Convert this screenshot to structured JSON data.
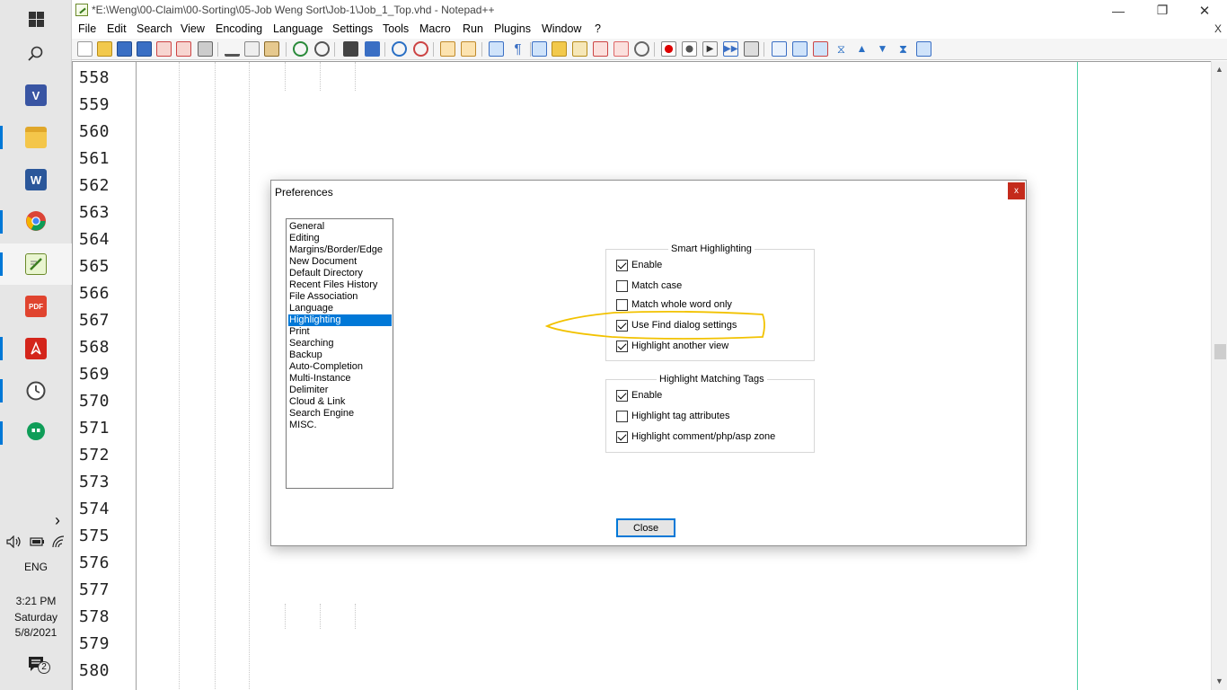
{
  "window": {
    "title": "*E:\\Weng\\00-Claim\\00-Sorting\\05-Job Weng Sort\\Job-1\\Job_1_Top.vhd - Notepad++",
    "minimize_glyph": "—",
    "maximize_glyph": "❐",
    "close_glyph": "✕"
  },
  "menu": {
    "items": [
      "File",
      "Edit",
      "Search",
      "View",
      "Encoding",
      "Language",
      "Settings",
      "Tools",
      "Macro",
      "Run",
      "Plugins",
      "Window",
      "?"
    ],
    "close_doc": "X"
  },
  "toolbar": {
    "icons": [
      "new-file",
      "open-file",
      "save",
      "save-all",
      "close",
      "close-all",
      "print",
      "cut",
      "copy",
      "paste",
      "undo",
      "redo",
      "find",
      "replace",
      "zoom-in",
      "zoom-out",
      "sync-vertical",
      "sync-horizontal",
      "word-wrap",
      "show-all-chars",
      "indent-guide",
      "udl",
      "doc-map",
      "function-list",
      "folder-workspace",
      "monitoring",
      "record-macro",
      "stop-record",
      "play-macro",
      "run-macro-multiple",
      "save-macro",
      "column-editor",
      "sort-ascending",
      "sort-descending",
      "fold",
      "move-up",
      "move-down",
      "unfold",
      "tab-bar"
    ]
  },
  "editor": {
    "line_numbers": [
      "558",
      "559",
      "560",
      "561",
      "562",
      "563",
      "564",
      "565",
      "566",
      "567",
      "568",
      "569",
      "570",
      "571",
      "572",
      "573",
      "574",
      "575",
      "576",
      "577",
      "578",
      "579",
      "580"
    ]
  },
  "taskbar": {
    "apps": [
      "windows-start",
      "search",
      "visio",
      "file-explorer",
      "word",
      "chrome",
      "notepad-plus-plus",
      "pdf-editor",
      "acrobat",
      "clock-app",
      "hangouts"
    ],
    "expand_glyph": "›",
    "language": "ENG",
    "time": "3:21 PM",
    "day": "Saturday",
    "date": "5/8/2021",
    "notification_count": "2"
  },
  "dialog": {
    "title": "Preferences",
    "close_glyph": "x",
    "categories": [
      "General",
      "Editing",
      "Margins/Border/Edge",
      "New Document",
      "Default Directory",
      "Recent Files History",
      "File Association",
      "Language",
      "Highlighting",
      "Print",
      "Searching",
      "Backup",
      "Auto-Completion",
      "Multi-Instance",
      "Delimiter",
      "Cloud & Link",
      "Search Engine",
      "MISC."
    ],
    "selected_category": "Highlighting",
    "smart_highlighting": {
      "label": "Smart Highlighting",
      "options": [
        {
          "label": "Enable",
          "checked": true
        },
        {
          "label": "Match case",
          "checked": false
        },
        {
          "label": "Match whole word only",
          "checked": false
        },
        {
          "label": "Use Find dialog settings",
          "checked": true
        },
        {
          "label": "Highlight another view",
          "checked": true
        }
      ]
    },
    "matching_tags": {
      "label": "Highlight Matching Tags",
      "options": [
        {
          "label": "Enable",
          "checked": true
        },
        {
          "label": "Highlight tag attributes",
          "checked": false
        },
        {
          "label": "Highlight comment/php/asp zone",
          "checked": true
        }
      ]
    },
    "close_button": "Close"
  },
  "colors": {
    "accent": "#0078d7",
    "annotation": "#f2c200",
    "edge_line": "#4fd1a8",
    "dialog_close": "#c42b1c"
  }
}
